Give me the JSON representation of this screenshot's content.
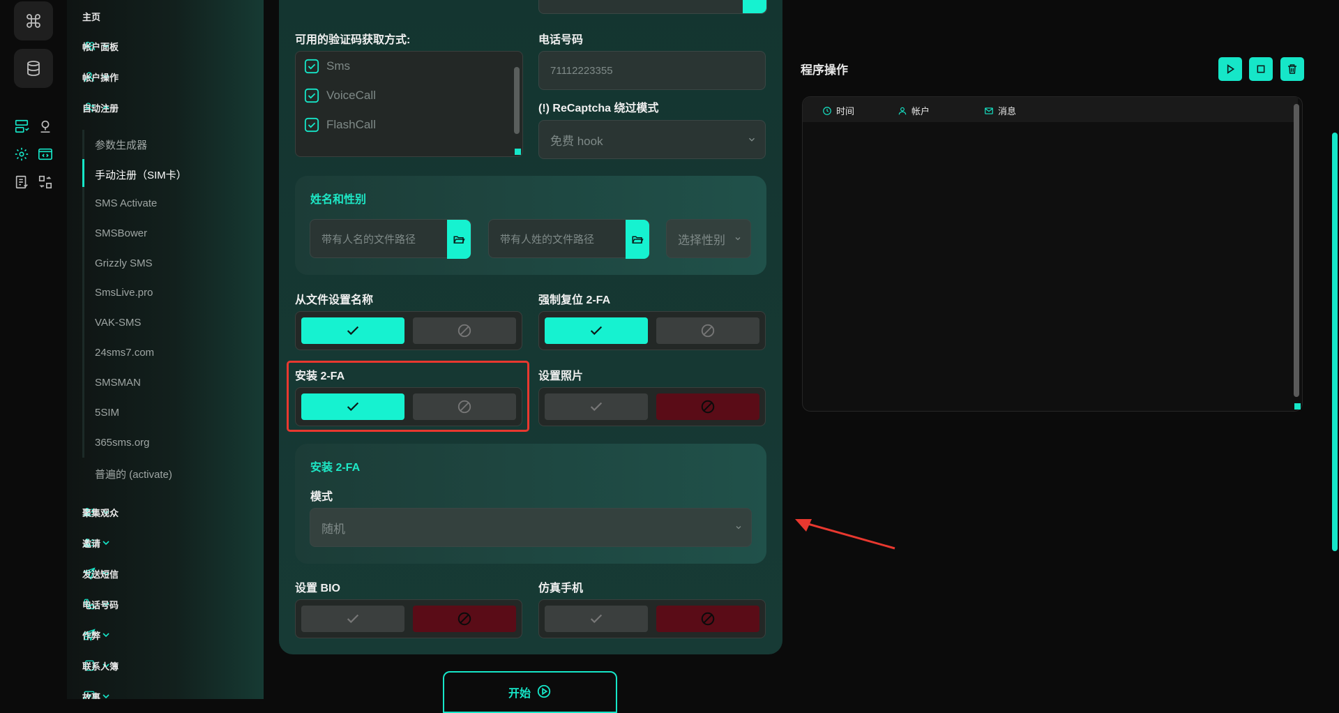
{
  "sidebar": {
    "home": "主页",
    "sections": [
      {
        "label": "帐户面板",
        "icon": "users-icon"
      },
      {
        "label": "帐户操作",
        "icon": "user-icon"
      },
      {
        "label": "自动注册",
        "icon": "user-plus-icon"
      }
    ],
    "sub_items": [
      "参数生成器",
      "手动注册（SIM卡）",
      "SMS Activate",
      "SMSBower",
      "Grizzly SMS",
      "SmsLive.pro",
      "VAK-SMS",
      "24sms7.com",
      "SMSMAN",
      "5SIM",
      "365sms.org",
      "普遍的 (activate)"
    ],
    "active_sub": "手动注册（SIM卡）",
    "bottom_sections": [
      {
        "label": "聚集观众",
        "icon": "users-gather-icon"
      },
      {
        "label": "邀请",
        "icon": "invite-icon"
      },
      {
        "label": "发送短信",
        "icon": "send-icon"
      },
      {
        "label": "电话号码",
        "icon": "phone-icon"
      },
      {
        "label": "作弊",
        "icon": "cheat-icon"
      },
      {
        "label": "联系人簿",
        "icon": "contacts-icon"
      },
      {
        "label": "故事",
        "icon": "story-icon"
      }
    ]
  },
  "form": {
    "verify_label": "可用的验证码获取方式:",
    "verify_options": [
      "Sms",
      "VoiceCall",
      "FlashCall"
    ],
    "phone_label": "电话号码",
    "phone_value": "71112223355",
    "recaptcha_label": "(!) ReCaptcha 绕过模式",
    "recaptcha_value": "免费 hook",
    "name_panel_title": "姓名和性别",
    "first_name_placeholder": "带有人名的文件路径",
    "last_name_placeholder": "带有人姓的文件路径",
    "gender_placeholder": "选择性别",
    "set_name_label": "从文件设置名称",
    "reset_2fa_label": "强制复位 2-FA",
    "install_2fa_label": "安装 2-FA",
    "set_photo_label": "设置照片",
    "twofa_panel_title": "安装 2-FA",
    "mode_label": "模式",
    "mode_value": "随机",
    "set_bio_label": "设置 BIO",
    "emulate_label": "仿真手机",
    "start_label": "开始"
  },
  "right": {
    "title": "程序操作",
    "columns": [
      "时间",
      "帐户",
      "消息"
    ]
  },
  "colors": {
    "accent": "#16f2d0",
    "danger": "#5a0c17",
    "annotation": "#e8382f"
  }
}
